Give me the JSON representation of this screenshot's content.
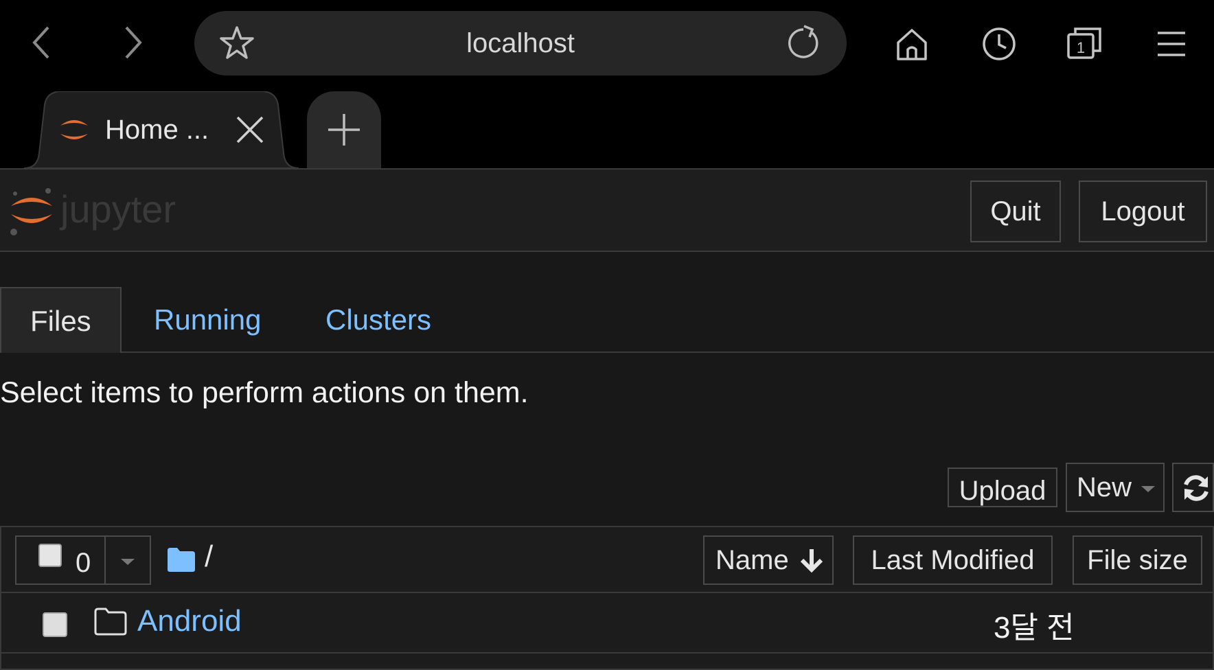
{
  "browser": {
    "url": "localhost",
    "tab_title": "Home ...",
    "tab_count": "1"
  },
  "header": {
    "logo_text": "jupyter",
    "quit_label": "Quit",
    "logout_label": "Logout"
  },
  "tabs": [
    {
      "label": "Files"
    },
    {
      "label": "Running"
    },
    {
      "label": "Clusters"
    }
  ],
  "hint": "Select items to perform actions on them.",
  "toolbar": {
    "upload_label": "Upload",
    "new_label": "New"
  },
  "list": {
    "selected_count": "0",
    "breadcrumb": "/",
    "columns": {
      "name": "Name",
      "last_modified": "Last Modified",
      "file_size": "File size"
    },
    "rows": [
      {
        "name": "Android",
        "modified": "3달 전",
        "type": "folder"
      }
    ]
  },
  "colors": {
    "link": "#7cc0ff",
    "jupyter_orange": "#e46e2e",
    "folder_blue": "#7cc0ff"
  }
}
